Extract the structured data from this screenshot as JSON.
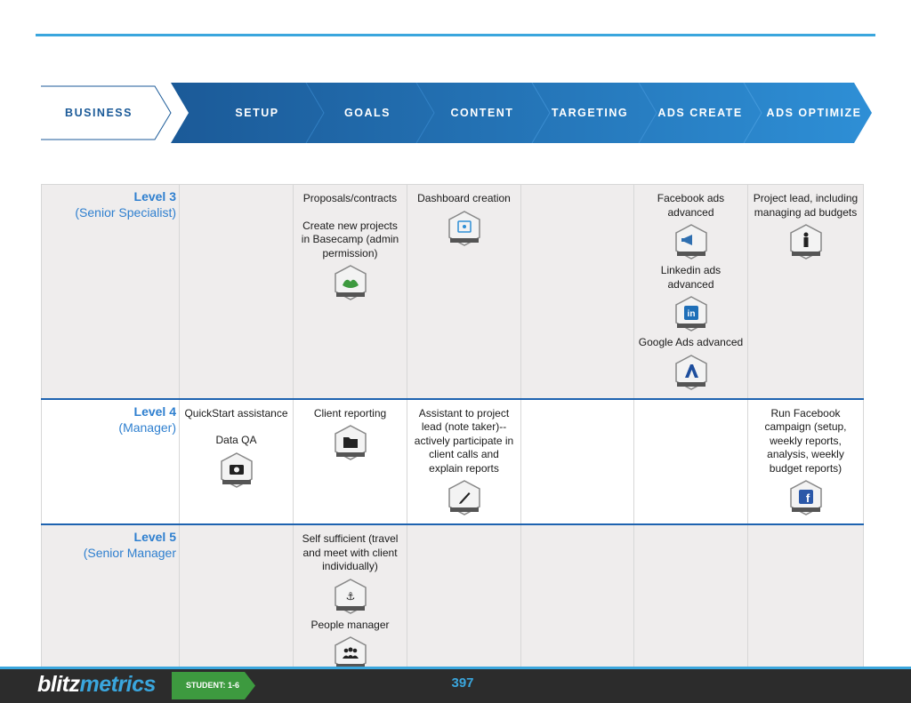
{
  "ribbon": {
    "steps": [
      "BUSINESS",
      "SETUP",
      "GOALS",
      "CONTENT",
      "TARGETING",
      "ADS CREATE",
      "ADS OPTIMIZE"
    ]
  },
  "rows": [
    {
      "level": "Level 3",
      "role": "(Senior Specialist)",
      "cells": {
        "goals": [
          {
            "text": "Proposals/contracts"
          },
          {
            "text": "Create new projects in Basecamp (admin permission)",
            "badge": "basecamp-icon",
            "badge_label": "BASECAMP ADMIN"
          }
        ],
        "content": [
          {
            "text": "Dashboard creation",
            "badge": "dashboard-icon",
            "badge_label": "DASHBOARD"
          }
        ],
        "ads_create": [
          {
            "text": "Facebook ads advanced",
            "badge": "megaphone-icon",
            "badge_label": "FB ADS ADV"
          },
          {
            "text": "Linkedin ads advanced",
            "badge": "linkedin-icon",
            "badge_label": "IN ADS ADV"
          },
          {
            "text": "Google Ads advanced",
            "badge": "google-ads-icon",
            "badge_label": "GOOGLE ADS ADV"
          }
        ],
        "ads_optimize": [
          {
            "text": "Project lead, including managing ad budgets",
            "badge": "person-icon",
            "badge_label": "PROJECT LEAD"
          }
        ]
      }
    },
    {
      "level": "Level 4",
      "role": "(Manager)",
      "cells": {
        "setup": [
          {
            "text": "QuickStart assistance"
          },
          {
            "text": "Data QA",
            "badge": "camera-icon",
            "badge_label": "QUICKSTART ASST"
          }
        ],
        "goals": [
          {
            "text": "Client reporting",
            "badge": "folder-icon",
            "badge_label": "CLIENT REPORT"
          }
        ],
        "content": [
          {
            "text": "Assistant to project lead (note taker)-- actively participate in client calls and explain reports",
            "badge": "pen-icon",
            "badge_label": "NOTE TAKER"
          }
        ],
        "ads_optimize": [
          {
            "text": "Run Facebook campaign (setup, weekly reports, analysis, weekly budget reports)",
            "badge": "facebook-icon",
            "badge_label": "FB CAMPAIGN"
          }
        ]
      }
    },
    {
      "level": "Level 5",
      "role": "(Senior Manager",
      "cells": {
        "goals": [
          {
            "text": "Self sufficient (travel and meet with client individually)",
            "badge": "anchor-icon",
            "badge_label": "SELF SUFFICIENT"
          },
          {
            "text": "People manager",
            "badge": "people-icon",
            "badge_label": "PEOPLE MANAGER"
          }
        ]
      }
    }
  ],
  "footer": {
    "logo_a": "blitz",
    "logo_b": "metrics",
    "student": "STUDENT: 1-6",
    "page": "397"
  },
  "colors": {
    "accent": "#3aa6dd",
    "ribbon_dark": "#1b5a98",
    "ribbon_light": "#2e8fd6",
    "level_text": "#2e7fcf",
    "row_rule": "#1e63b0",
    "badge_green": "#3d9a3f"
  }
}
